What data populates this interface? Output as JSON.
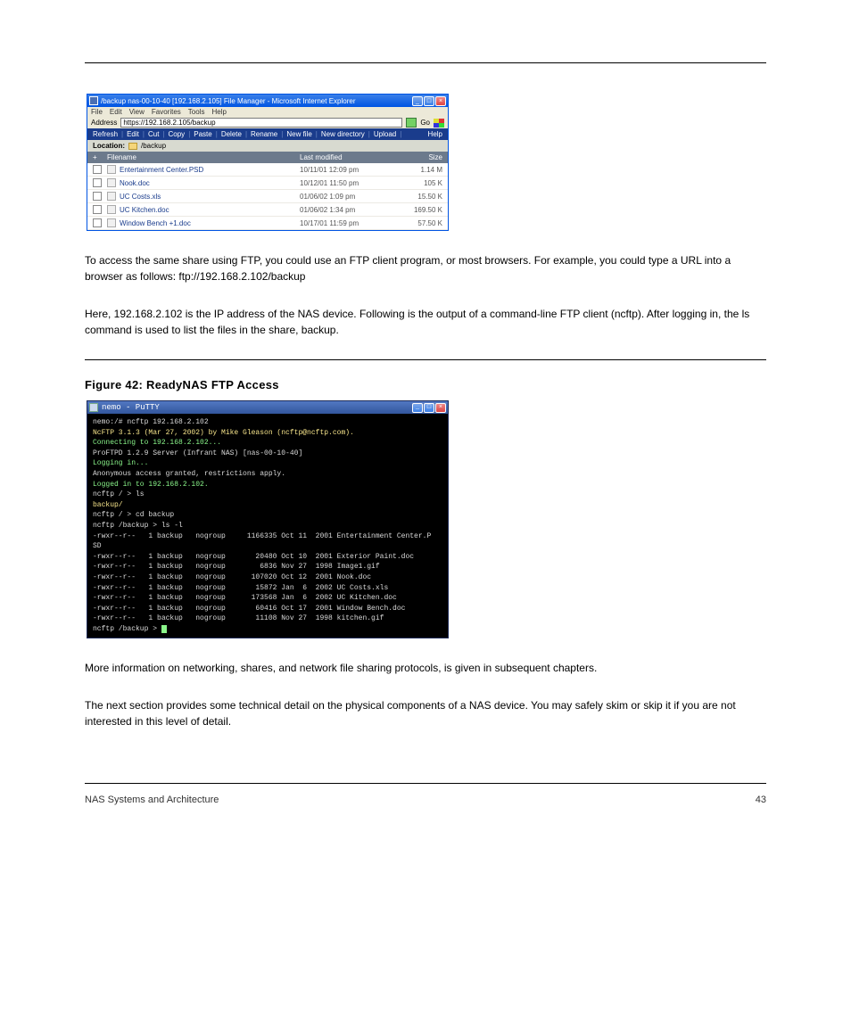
{
  "ie": {
    "title": "/backup nas-00-10-40 [192.168.2.105] File Manager - Microsoft Internet Explorer",
    "menu": {
      "file": "File",
      "edit": "Edit",
      "view": "View",
      "favorites": "Favorites",
      "tools": "Tools",
      "help": "Help"
    },
    "address_label": "Address",
    "address_value": "https://192.168.2.105/backup",
    "go": "Go",
    "toolbar": {
      "refresh": "Refresh",
      "edit": "Edit",
      "cut": "Cut",
      "copy": "Copy",
      "paste": "Paste",
      "delete": "Delete",
      "rename": "Rename",
      "newfile": "New file",
      "newdir": "New directory",
      "upload": "Upload",
      "help": "Help"
    },
    "location_label": "Location:",
    "location_path": "/backup",
    "headers": {
      "filename": "Filename",
      "modified": "Last modified",
      "size": "Size"
    },
    "rows": [
      {
        "name": "Entertainment Center.PSD",
        "mod": "10/11/01 12:09 pm",
        "size": "1.14 M"
      },
      {
        "name": "Nook.doc",
        "mod": "10/12/01 11:50 pm",
        "size": "105 K"
      },
      {
        "name": "UC Costs.xls",
        "mod": "01/06/02 1:09 pm",
        "size": "15.50 K"
      },
      {
        "name": "UC Kitchen.doc",
        "mod": "01/06/02 1:34 pm",
        "size": "169.50 K"
      },
      {
        "name": "Window Bench +1.doc",
        "mod": "10/17/01 11:59 pm",
        "size": "57.50 K"
      }
    ]
  },
  "body1": "To access the same share using FTP, you could use an FTP client program, or most browsers. For example, you could type a URL into a browser as follows:  ftp://192.168.2.102/backup",
  "body1b": "Here, 192.168.2.102 is the IP address of the NAS device. Following is the output of a command-line FTP client (ncftp).  After logging in, the ls command is used to list the files in the share, backup.",
  "h3": "Figure 42:  ReadyNAS FTP Access",
  "putty": {
    "title": "nemo - PuTTY",
    "lines": [
      "nemo:/# ncftp 192.168.2.102",
      {
        "cls": "y",
        "t": "NcFTP 3.1.3 (Mar 27, 2002) by Mike Gleason (ncftp@ncftp.com)."
      },
      {
        "cls": "g",
        "t": "Connecting to 192.168.2.102..."
      },
      "ProFTPD 1.2.9 Server (Infrant NAS) [nas-00-10-40]",
      {
        "cls": "g",
        "t": "Logging in..."
      },
      "Anonymous access granted, restrictions apply.",
      {
        "cls": "g",
        "t": "Logged in to 192.168.2.102."
      },
      "ncftp / > ls",
      {
        "cls": "y",
        "t": "backup/"
      },
      "ncftp / > cd backup",
      "ncftp /backup > ls -l",
      "-rwxr--r--   1 backup   nogroup     1166335 Oct 11  2001 Entertainment Center.P",
      "SD",
      "-rwxr--r--   1 backup   nogroup       20480 Oct 10  2001 Exterior Paint.doc",
      "-rwxr--r--   1 backup   nogroup        6836 Nov 27  1998 Image1.gif",
      "-rwxr--r--   1 backup   nogroup      107020 Oct 12  2001 Nook.doc",
      "-rwxr--r--   1 backup   nogroup       15872 Jan  6  2002 UC Costs.xls",
      "-rwxr--r--   1 backup   nogroup      173568 Jan  6  2002 UC Kitchen.doc",
      "-rwxr--r--   1 backup   nogroup       60416 Oct 17  2001 Window Bench.doc",
      "-rwxr--r--   1 backup   nogroup       11108 Nov 27  1998 kitchen.gif",
      {
        "t": "ncftp /backup > ",
        "cursor": true
      }
    ]
  },
  "body2a": "More information on networking, shares, and network file sharing protocols, is given in subsequent chapters.",
  "body2b": "The next section provides some technical detail on the physical components of a NAS device.  You may safely skim or skip it if you are not interested in this level of detail.",
  "footer": {
    "left": "NAS Systems and Architecture",
    "right": "43"
  }
}
